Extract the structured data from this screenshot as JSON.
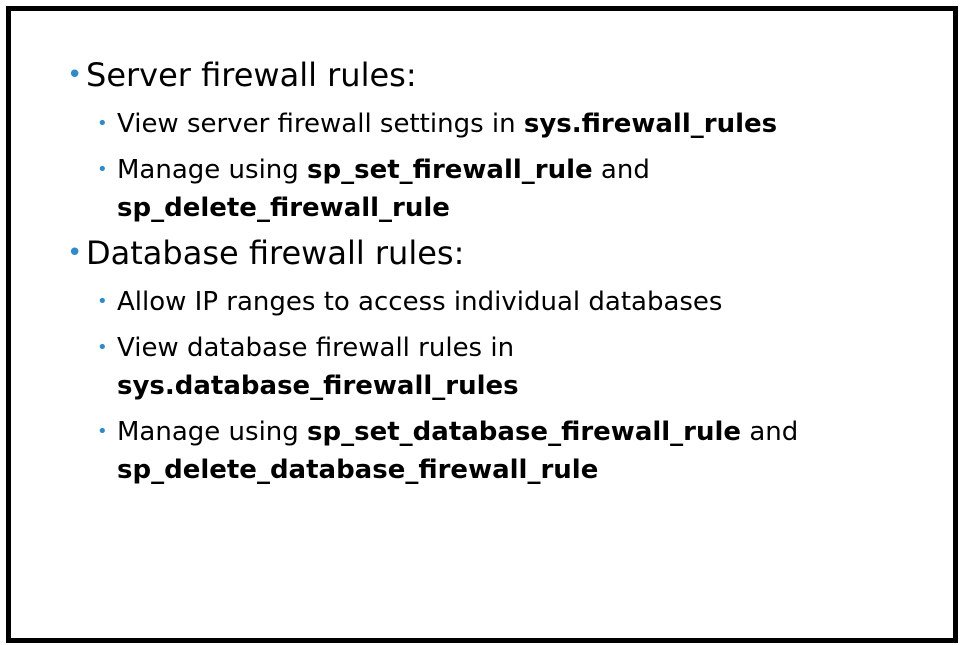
{
  "sections": [
    {
      "heading": "Server firewall rules:",
      "items": [
        {
          "text": "View server firewall settings in ",
          "bold": "sys.firewall_rules",
          "text2": "",
          "bold2": ""
        },
        {
          "text": "Manage using ",
          "bold": "sp_set_firewall_rule",
          "text2": " and",
          "bold2": "sp_delete_firewall_rule"
        }
      ]
    },
    {
      "heading": "Database firewall rules:",
      "items": [
        {
          "text": "Allow IP ranges to access individual databases",
          "bold": "",
          "text2": "",
          "bold2": ""
        },
        {
          "text": "View database firewall rules in",
          "bold": "",
          "text2": "",
          "bold2": "sys.database_firewall_rules"
        },
        {
          "text": "Manage using ",
          "bold": "sp_set_database_firewall_rule",
          "text2": " and",
          "bold2": "sp_delete_database_firewall_rule"
        }
      ]
    }
  ],
  "colors": {
    "bullet": "#2e8bc6",
    "border": "#000000"
  },
  "icons": {
    "bullet": "bullet-dot-icon"
  }
}
